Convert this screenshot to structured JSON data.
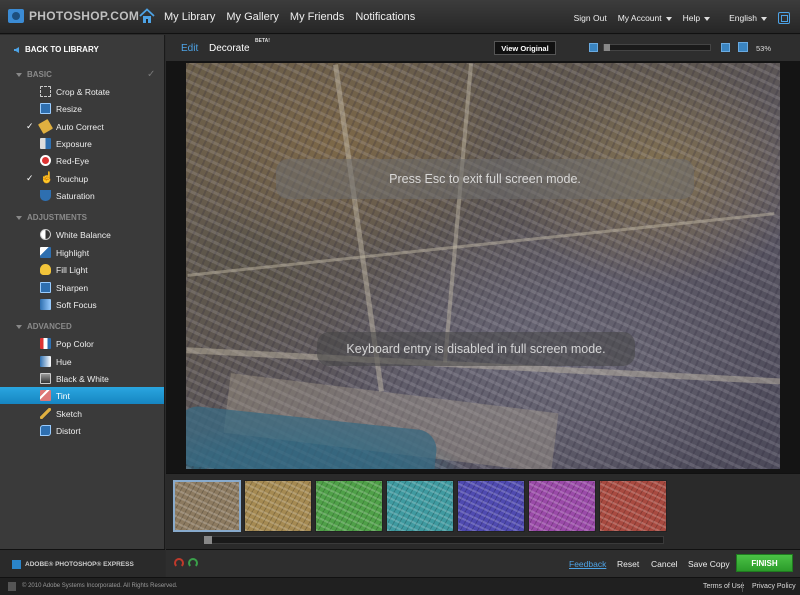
{
  "topbar": {
    "logo": "PHOTOSHOP.COM",
    "nav": [
      "My Library",
      "My Gallery",
      "My Friends",
      "Notifications"
    ],
    "sign_out": "Sign Out",
    "my_account": "My Account",
    "help": "Help",
    "language": "English"
  },
  "sidebar": {
    "back": "BACK TO LIBRARY",
    "sections": {
      "basic": "BASIC",
      "adjustments": "ADJUSTMENTS",
      "advanced": "ADVANCED"
    },
    "items": {
      "crop_rotate": "Crop & Rotate",
      "resize": "Resize",
      "auto_correct": "Auto Correct",
      "exposure": "Exposure",
      "red_eye": "Red-Eye",
      "touchup": "Touchup",
      "saturation": "Saturation",
      "white_balance": "White Balance",
      "highlight": "Highlight",
      "fill_light": "Fill Light",
      "sharpen": "Sharpen",
      "soft_focus": "Soft Focus",
      "pop_color": "Pop Color",
      "hue": "Hue",
      "black_white": "Black & White",
      "tint": "Tint",
      "sketch": "Sketch",
      "distort": "Distort"
    },
    "applied": [
      "Auto Correct",
      "Touchup"
    ],
    "selected": "Tint",
    "brand": "ADOBE® PHOTOSHOP® EXPRESS"
  },
  "toolbar": {
    "tab_edit": "Edit",
    "tab_decorate": "Decorate",
    "beta": "BETA!",
    "view_original": "View Original",
    "zoom": "53%"
  },
  "canvas": {
    "toast_esc": "Press Esc to exit full screen mode.",
    "toast_keyboard": "Keyboard entry is disabled in full screen mode."
  },
  "filmstrip": {
    "tints": [
      "#8c7a60",
      "#a58a52",
      "#4fa048",
      "#3f9aa0",
      "#4f4ab0",
      "#9a4aa8",
      "#a84a40"
    ],
    "selected_index": 0
  },
  "actions": {
    "feedback": "Feedback",
    "reset": "Reset",
    "cancel": "Cancel",
    "save_copy": "Save Copy",
    "finish": "FINISH"
  },
  "footer": {
    "copyright": "© 2010 Adobe Systems Incorporated. All Rights Reserved.",
    "terms": "Terms of Use",
    "privacy": "Privacy Policy"
  },
  "colors": {
    "accent": "#1e96d4",
    "finish": "#35aa33",
    "link": "#4da3e6"
  }
}
